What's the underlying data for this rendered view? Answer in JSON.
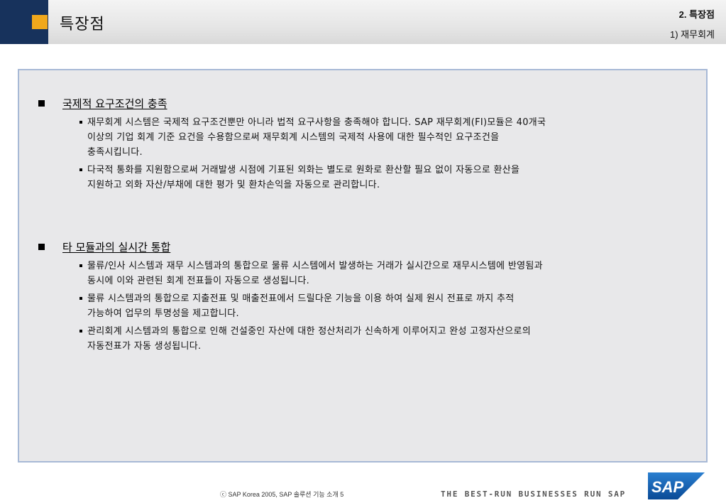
{
  "header": {
    "title": "특장점",
    "section_line1": "2. 특장점",
    "section_line2": "1) 재무회계",
    "navy_color": "#17325c",
    "accent_color": "#f0a81c"
  },
  "sections": [
    {
      "title": "국제적 요구조건의 충족",
      "items": [
        {
          "lines": [
            "재무회계 시스템은 국제적 요구조건뿐만 아니라 법적 요구사항을 충족해야 합니다. SAP 재무회계(FI)모듈은 40개국",
            "이상의 기업 회계 기준 요건을 수용함으로써 재무회계 시스템의 국제적 사용에 대한 필수적인 요구조건을",
            "충족시킵니다."
          ]
        },
        {
          "lines": [
            "다국적 통화를 지원함으로써 거래발생 시점에 기표된 외화는 별도로 원화로 환산할 필요 없이 자동으로 환산을",
            "지원하고 외화 자산/부채에 대한 평가 및 환차손익을 자동으로 관리합니다."
          ]
        }
      ]
    },
    {
      "title": "타 모듈과의 실시간 통합",
      "items": [
        {
          "lines": [
            "물류/인사 시스템과 재무 시스템과의 통합으로 물류 시스템에서 발생하는 거래가 실시간으로 재무시스템에 반영됨과",
            "동시에 이와 관련된 회계 전표들이 자동으로 생성됩니다."
          ]
        },
        {
          "lines": [
            "물류 시스템과의 통합으로 지출전표 및 매출전표에서 드릴다운 기능을 이용 하여 실제 원시 전표로 까지 추적",
            "가능하여 업무의 투명성을 제고합니다."
          ]
        },
        {
          "lines": [
            "관리회계 시스템과의 통합으로 인해 건설중인 자산에 대한 정산처리가 신속하게 이루어지고 완성 고정자산으로의",
            "자동전표가 자동 생성됩니다."
          ]
        }
      ]
    }
  ],
  "footer": {
    "copyright": "ⓒ  SAP Korea 2005, SAP 솔루션 기능 소개    5",
    "tagline": "THE BEST-RUN BUSINESSES RUN SAP",
    "logo_text": "SAP",
    "logo_color": "#0a5aa8"
  }
}
